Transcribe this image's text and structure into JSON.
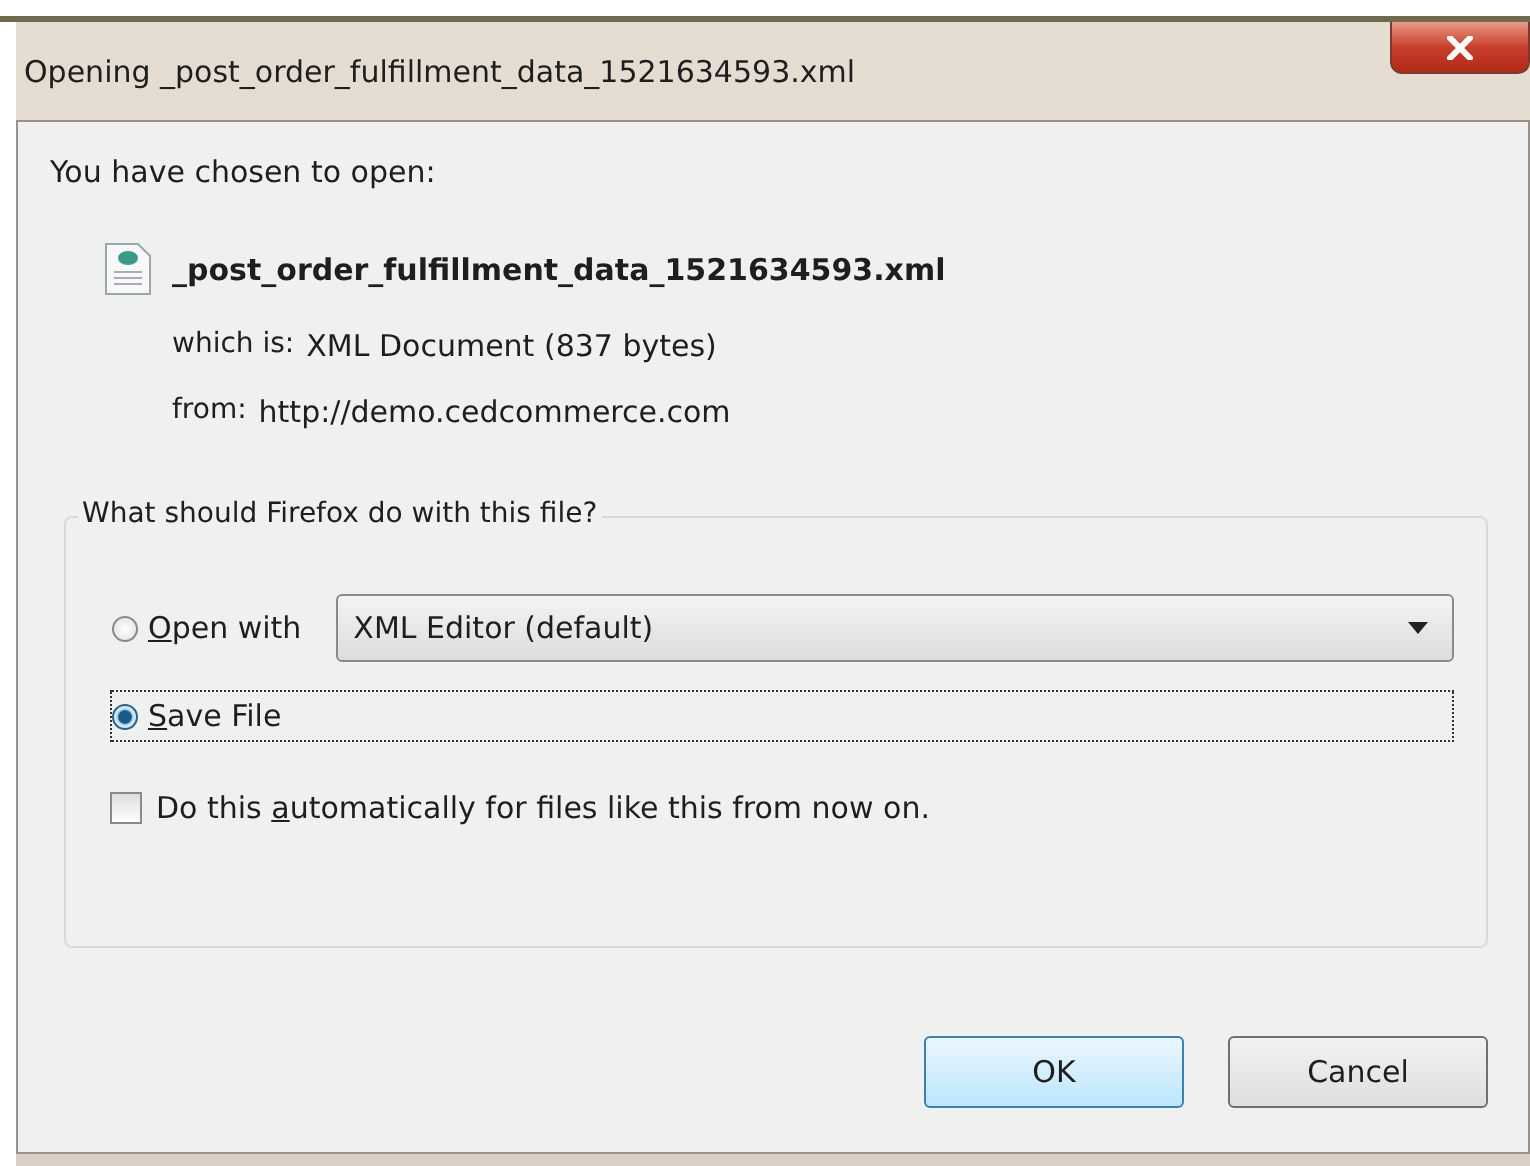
{
  "window": {
    "title": "Opening _post_order_fulfillment_data_1521634593.xml"
  },
  "intro": "You have chosen to open:",
  "file": {
    "name": "_post_order_fulfillment_data_1521634593.xml",
    "details": [
      {
        "label": "which is:",
        "value": "XML Document (837 bytes)"
      },
      {
        "label": "from:",
        "value": "http://demo.cedcommerce.com"
      }
    ]
  },
  "action_group": {
    "legend": "What should Firefox do with this file?",
    "options": [
      {
        "key": "O",
        "post": "pen with",
        "selected": false,
        "focused": false,
        "dropdown": "XML Editor (default)"
      },
      {
        "key": "S",
        "post": "ave File",
        "selected": true,
        "focused": true
      }
    ],
    "auto": {
      "pre": "Do this ",
      "key": "a",
      "post": "utomatically for files like this from now on.",
      "checked": false
    }
  },
  "buttons": [
    {
      "label": "OK",
      "default": true
    },
    {
      "label": "Cancel",
      "default": false
    }
  ]
}
